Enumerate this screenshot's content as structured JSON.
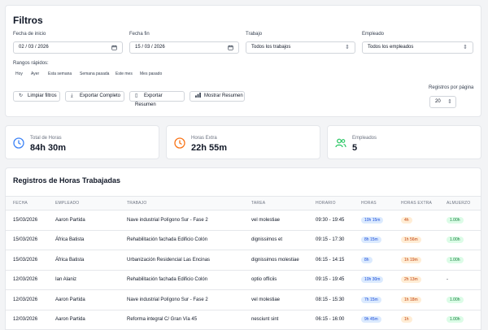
{
  "filters": {
    "title": "Filtros",
    "fecha_inicio": {
      "label": "Fecha de inicio",
      "value": "02 / 03 / 2026"
    },
    "fecha_fin": {
      "label": "Fecha fin",
      "value": "15 / 03 / 2026"
    },
    "trabajo": {
      "label": "Trabajo",
      "value": "Todos los trabajos"
    },
    "empleado": {
      "label": "Empleado",
      "value": "Todos los empleados"
    },
    "quick_label": "Rangos rápidos:",
    "quick": [
      "Hoy",
      "Ayer",
      "Esta semana",
      "Semana pasada",
      "Este mes",
      "Mes pasado"
    ],
    "buttons": {
      "limpiar": "Limpiar filtros",
      "exportar_completo": "Exportar Completo",
      "exportar_resumen": "Exportar Resumen",
      "mostrar_resumen": "Mostrar Resumen"
    },
    "per_page": {
      "label": "Registros por página",
      "value": "20"
    }
  },
  "stats": [
    {
      "label": "Total de Horas",
      "value": "84h 30m",
      "icon": "clock-icon",
      "color": "#3b82f6"
    },
    {
      "label": "Horas Extra",
      "value": "22h 55m",
      "icon": "clock-icon",
      "color": "#f97316"
    },
    {
      "label": "Empleados",
      "value": "5",
      "icon": "users-icon",
      "color": "#22c55e"
    }
  ],
  "table": {
    "title": "Registros de Horas Trabajadas",
    "columns": [
      "FECHA",
      "EMPLEADO",
      "TRABAJO",
      "TAREA",
      "HORARIO",
      "HORAS",
      "HORAS EXTRA",
      "ALMUERZO"
    ],
    "rows": [
      {
        "fecha": "15/03/2026",
        "empleado": "Aaron Partida",
        "trabajo": "Nave industrial Polígono Sur - Fase 2",
        "tarea": "vel molestiae",
        "horario": "09:30 - 19:45",
        "horas": "10h 15m",
        "extra": "4h",
        "almuerzo": "1.00h"
      },
      {
        "fecha": "15/03/2026",
        "empleado": "África Batista",
        "trabajo": "Rehabilitación fachada Edificio Colón",
        "tarea": "dignissimos et",
        "horario": "09:15 - 17:30",
        "horas": "8h 15m",
        "extra": "1h 56m",
        "almuerzo": "1.00h"
      },
      {
        "fecha": "15/03/2026",
        "empleado": "África Batista",
        "trabajo": "Urbanización Residencial Las Encinas",
        "tarea": "dignissimos molestiae",
        "horario": "06:15 - 14:15",
        "horas": "8h",
        "extra": "1h 19m",
        "almuerzo": "1.00h"
      },
      {
        "fecha": "12/03/2026",
        "empleado": "Ian Alaniz",
        "trabajo": "Rehabilitación fachada Edificio Colón",
        "tarea": "optio officiis",
        "horario": "09:15 - 19:45",
        "horas": "10h 30m",
        "extra": "2h 13m",
        "almuerzo": "-"
      },
      {
        "fecha": "12/03/2026",
        "empleado": "Aaron Partida",
        "trabajo": "Nave industrial Polígono Sur - Fase 2",
        "tarea": "vel molestiae",
        "horario": "08:15 - 15:30",
        "horas": "7h 15m",
        "extra": "1h 18m",
        "almuerzo": "1.00h"
      },
      {
        "fecha": "12/03/2026",
        "empleado": "Aaron Partida",
        "trabajo": "Reforma integral C/ Gran Vía 45",
        "tarea": "nesciunt sint",
        "horario": "06:15 - 16:00",
        "horas": "9h 45m",
        "extra": "1h",
        "almuerzo": "1.00h"
      }
    ]
  }
}
